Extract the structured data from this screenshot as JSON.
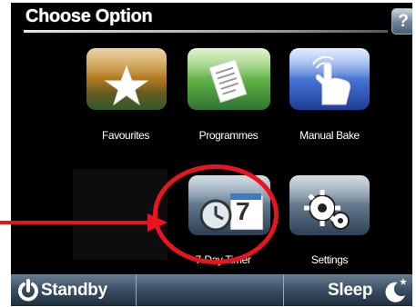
{
  "header": {
    "title": "Choose Option",
    "help_label": "?"
  },
  "menu": {
    "favourites_label": "Favourites",
    "programmes_label": "Programmes",
    "manual_bake_label": "Manual Bake",
    "timer_label": "7-Day Timer",
    "timer_digit": "7",
    "settings_label": "Settings"
  },
  "footer": {
    "standby_label": "Standby",
    "sleep_label": "Sleep"
  },
  "annotation": {
    "color": "#e8141e"
  },
  "icons": [
    "star-icon",
    "document-icon",
    "hand-pointer-icon",
    "clock-calendar-icon",
    "gears-icon",
    "power-icon",
    "moon-icon"
  ]
}
